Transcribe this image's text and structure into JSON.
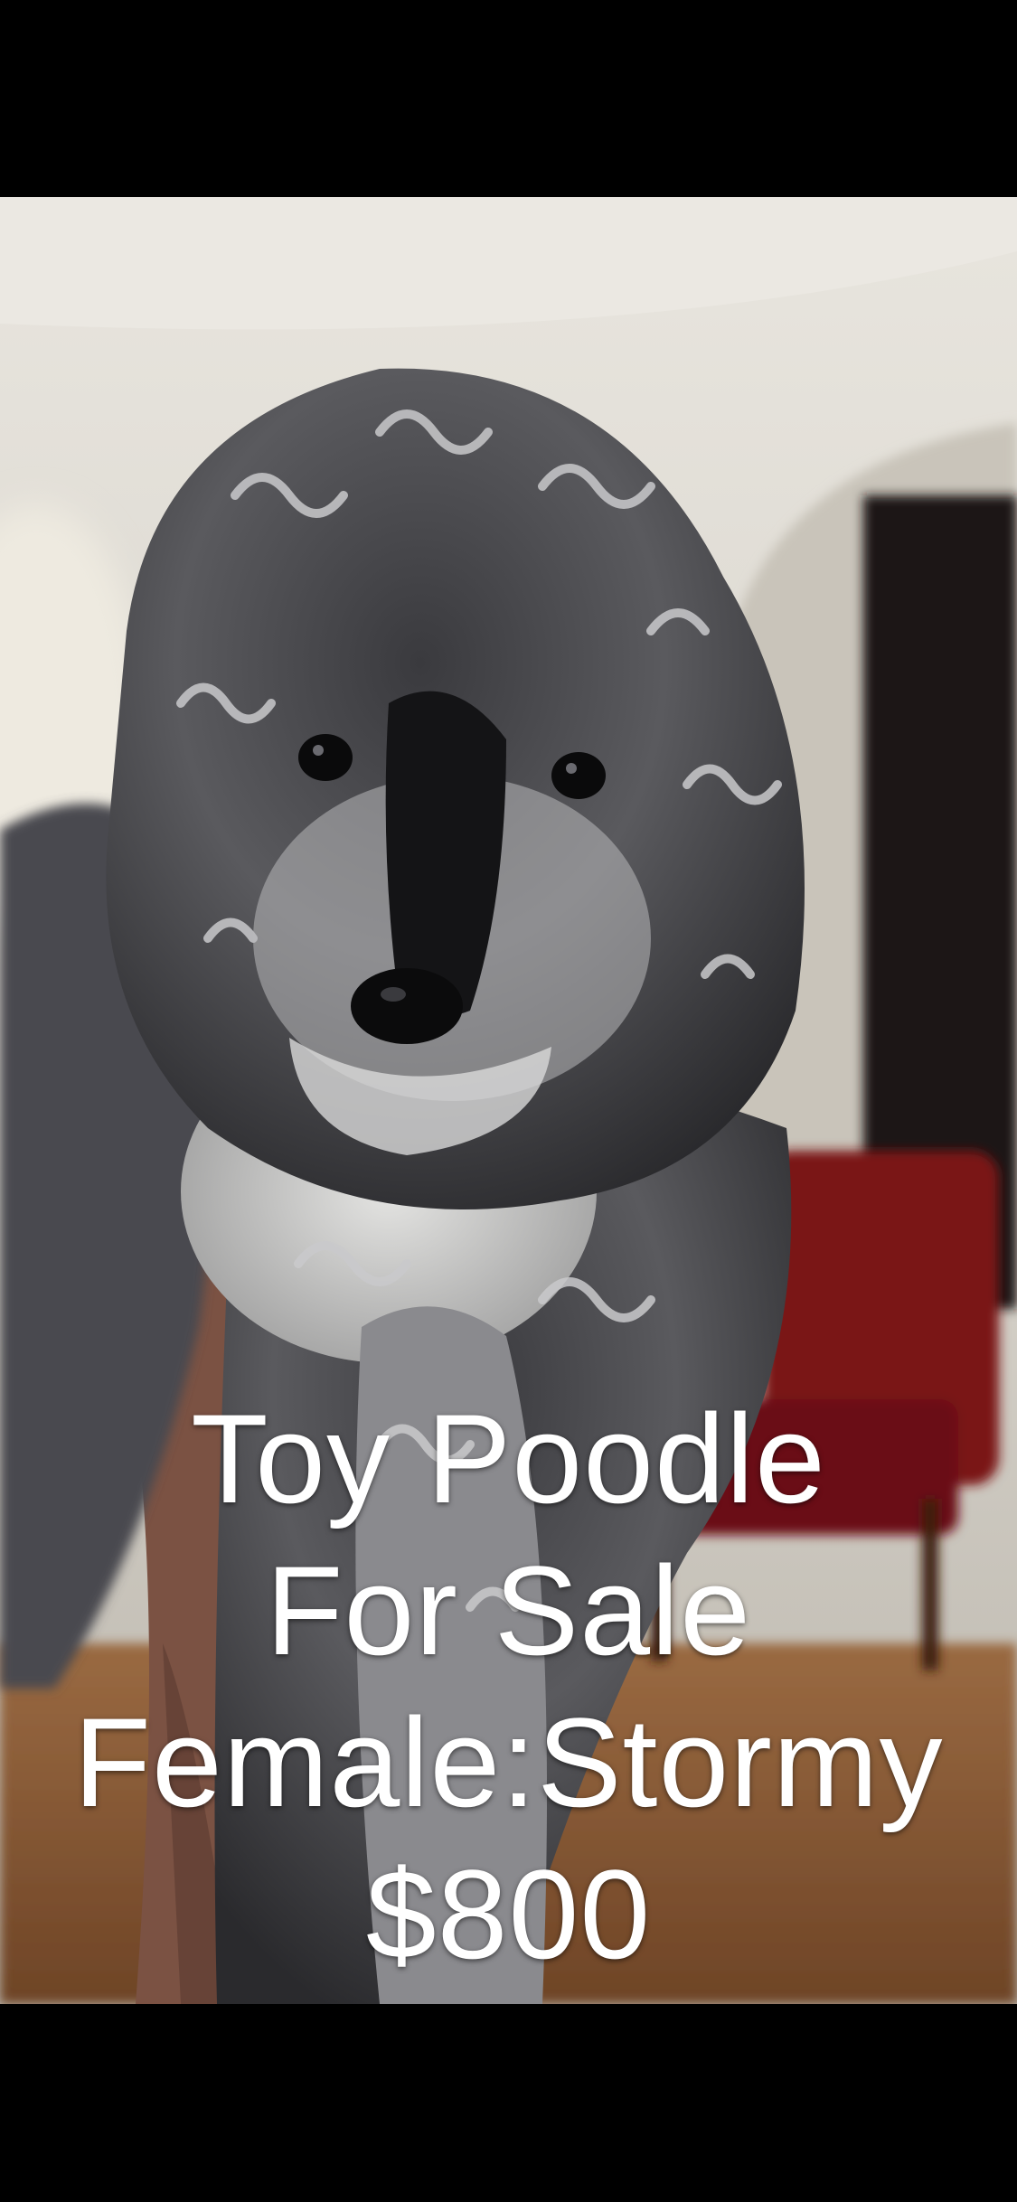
{
  "caption": {
    "line1": "Toy Poodle",
    "line2": "For Sale",
    "line3": "Female:Stormy",
    "line4": "$800"
  },
  "colors": {
    "letterbox": "#000000",
    "wall": "#d9d6cf",
    "ceiling": "#e6e3dc",
    "floor": "#8a5a33",
    "chair": "#7a1417",
    "doorway": "#1a1716",
    "fur_dark": "#1f1f22",
    "fur_light": "#bdbdbd",
    "caption_text": "#ffffff"
  },
  "icons": {
    "subject": "merle-toy-poodle-puppy"
  }
}
